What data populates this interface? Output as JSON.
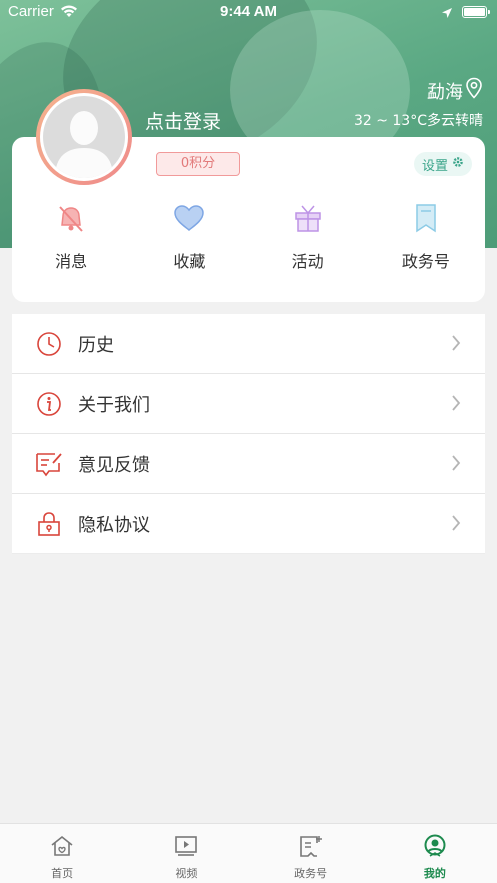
{
  "status_bar": {
    "carrier": "Carrier",
    "time": "9:44 AM"
  },
  "weather": {
    "city": "勐海",
    "summary": "32 ~ 13°C多云转晴"
  },
  "profile": {
    "login_text": "点击登录",
    "points": "0积分",
    "settings_label": "设置"
  },
  "quick_actions": [
    {
      "label": "消息",
      "icon": "bell-muted-icon",
      "color": "#f08f8f"
    },
    {
      "label": "收藏",
      "icon": "heart-icon",
      "color": "#8fb4ea"
    },
    {
      "label": "活动",
      "icon": "gift-icon",
      "color": "#c9a7ea"
    },
    {
      "label": "政务号",
      "icon": "bookmark-icon",
      "color": "#9fd3ea"
    }
  ],
  "menu": [
    {
      "label": "历史",
      "icon": "clock-icon"
    },
    {
      "label": "关于我们",
      "icon": "info-icon"
    },
    {
      "label": "意见反馈",
      "icon": "feedback-icon"
    },
    {
      "label": "隐私协议",
      "icon": "lock-icon"
    }
  ],
  "tabs": [
    {
      "label": "首页",
      "icon": "home-icon",
      "active": false
    },
    {
      "label": "视频",
      "icon": "video-icon",
      "active": false
    },
    {
      "label": "政务号",
      "icon": "gov-icon",
      "active": false
    },
    {
      "label": "我的",
      "icon": "profile-icon",
      "active": true
    }
  ],
  "colors": {
    "brand_green": "#1d8a4e",
    "accent_red": "#d9453b",
    "header_green": "#5aa883"
  }
}
